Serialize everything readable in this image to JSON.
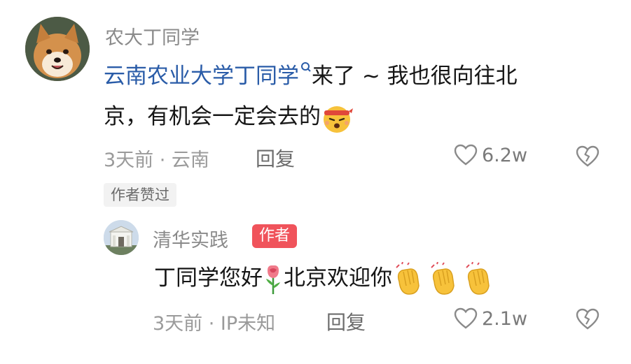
{
  "comment": {
    "username": "农大丁同学",
    "link_text": "云南农业大学丁同学",
    "text_line1_rest": "来了 ~ 我也很向往北",
    "text_line2": "京，有机会一定会去的",
    "emoji_icon": "headband-emoji-icon",
    "meta": "3天前 · 云南",
    "reply_label": "回复",
    "like_count": "6.2w",
    "author_liked_badge": "作者赞过"
  },
  "reply": {
    "username": "清华实践",
    "author_badge": "作者",
    "text": "丁同学您好",
    "text2": "北京欢迎你",
    "emoji_icons": [
      "rose-emoji-icon",
      "clapping-hands-emoji-icon",
      "clapping-hands-emoji-icon",
      "clapping-hands-emoji-icon"
    ],
    "meta": "3天前 · IP未知",
    "reply_label": "回复",
    "like_count": "2.1w"
  },
  "colors": {
    "link_blue": "#2a5ca8",
    "author_badge_red": "#f0535b",
    "muted_gray": "#9a9a9a"
  }
}
